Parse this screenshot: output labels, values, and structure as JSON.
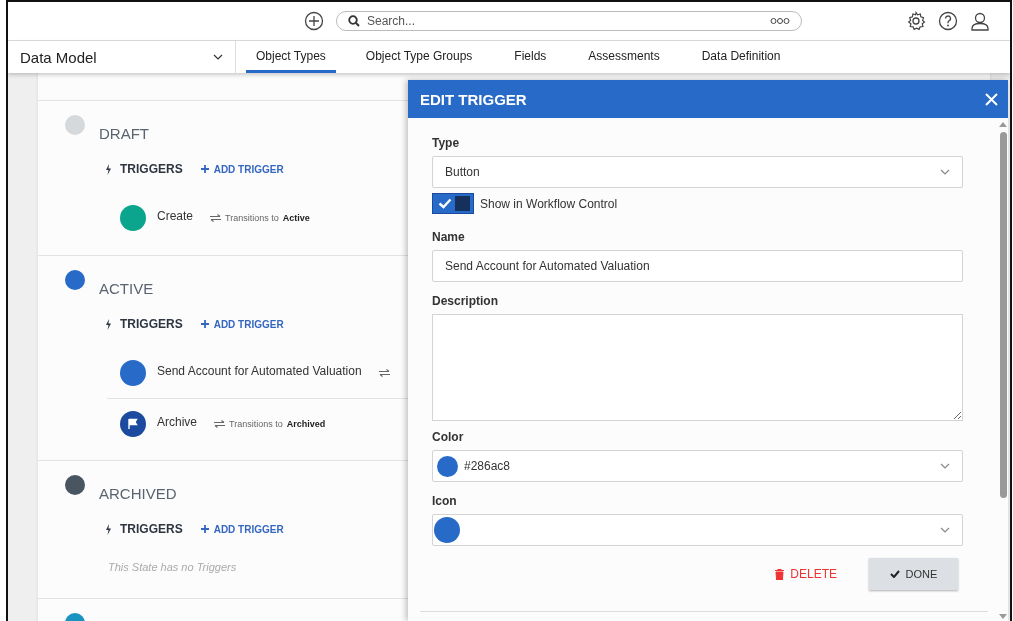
{
  "topbar": {
    "search": {
      "placeholder": "Search..."
    }
  },
  "nav": {
    "title": "Data Model",
    "tabs": [
      {
        "label": "Object Types",
        "selected": true
      },
      {
        "label": "Object Type Groups",
        "selected": false
      },
      {
        "label": "Fields",
        "selected": false
      },
      {
        "label": "Assessments",
        "selected": false
      },
      {
        "label": "Data Definition",
        "selected": false
      }
    ]
  },
  "states": [
    {
      "name": "DRAFT",
      "color": "#d6d9dc",
      "triggers_label": "TRIGGERS",
      "add_label": "ADD TRIGGER",
      "triggers": [
        {
          "name": "Create",
          "color": "#0aa58c",
          "kind": "plain",
          "transition_label": "Transitions to",
          "target": "Active"
        }
      ]
    },
    {
      "name": "ACTIVE",
      "color": "#286ac8",
      "triggers_label": "TRIGGERS",
      "add_label": "ADD TRIGGER",
      "triggers": [
        {
          "name": "Send Account for Automated Valuation",
          "color": "#286ac8",
          "kind": "plain"
        },
        {
          "name": "Archive",
          "color": "#1b4a9e",
          "kind": "flag",
          "transition_label": "Transitions to",
          "target": "Archived"
        }
      ]
    },
    {
      "name": "ARCHIVED",
      "color": "#4a5562",
      "triggers_label": "TRIGGERS",
      "add_label": "ADD TRIGGER",
      "empty_text": "This State has no Triggers"
    },
    {
      "color": "#1a93c0"
    }
  ],
  "panel": {
    "title": "EDIT TRIGGER",
    "fields": [
      {
        "kind": "select",
        "label": "Type",
        "value": "Button"
      },
      {
        "kind": "toggle",
        "label": "Show in Workflow Control",
        "checked": true
      },
      {
        "kind": "text",
        "label": "Name",
        "value": "Send Account for Automated Valuation"
      },
      {
        "kind": "textarea",
        "label": "Description"
      },
      {
        "kind": "color",
        "label": "Color",
        "value": "#286ac8"
      },
      {
        "kind": "icon",
        "label": "Icon",
        "color": "#286ac8"
      }
    ],
    "buttons": [
      {
        "kind": "delete",
        "label": "DELETE"
      },
      {
        "kind": "done",
        "label": "DONE"
      }
    ]
  }
}
